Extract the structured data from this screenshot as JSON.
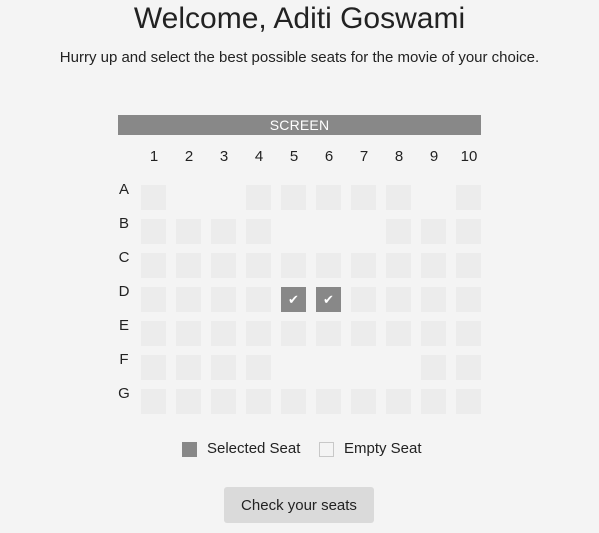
{
  "header": {
    "title": "Welcome, Aditi Goswami",
    "subtitle": "Hurry up and select the best possible seats for the movie of your choice."
  },
  "screen_label": "SCREEN",
  "columns": [
    "1",
    "2",
    "3",
    "4",
    "5",
    "6",
    "7",
    "8",
    "9",
    "10"
  ],
  "rows": [
    {
      "label": "A",
      "seats": [
        1,
        4,
        5,
        6,
        7,
        8,
        10
      ],
      "selected": []
    },
    {
      "label": "B",
      "seats": [
        1,
        2,
        3,
        4,
        8,
        9,
        10
      ],
      "selected": []
    },
    {
      "label": "C",
      "seats": [
        1,
        2,
        3,
        4,
        5,
        6,
        7,
        8,
        9,
        10
      ],
      "selected": []
    },
    {
      "label": "D",
      "seats": [
        1,
        2,
        3,
        4,
        5,
        6,
        7,
        8,
        9,
        10
      ],
      "selected": [
        5,
        6
      ]
    },
    {
      "label": "E",
      "seats": [
        1,
        2,
        3,
        4,
        5,
        6,
        7,
        8,
        9,
        10
      ],
      "selected": []
    },
    {
      "label": "F",
      "seats": [
        1,
        2,
        3,
        4,
        9,
        10
      ],
      "selected": []
    },
    {
      "label": "G",
      "seats": [
        1,
        2,
        3,
        4,
        5,
        6,
        7,
        8,
        9,
        10
      ],
      "selected": []
    }
  ],
  "selected_mark": "✔",
  "legend": {
    "selected_label": "Selected Seat",
    "empty_label": "Empty Seat"
  },
  "check_button_label": "Check your seats",
  "colors": {
    "selected": "#888888",
    "empty": "#ececec",
    "screen": "#888888",
    "button": "#dadada"
  }
}
